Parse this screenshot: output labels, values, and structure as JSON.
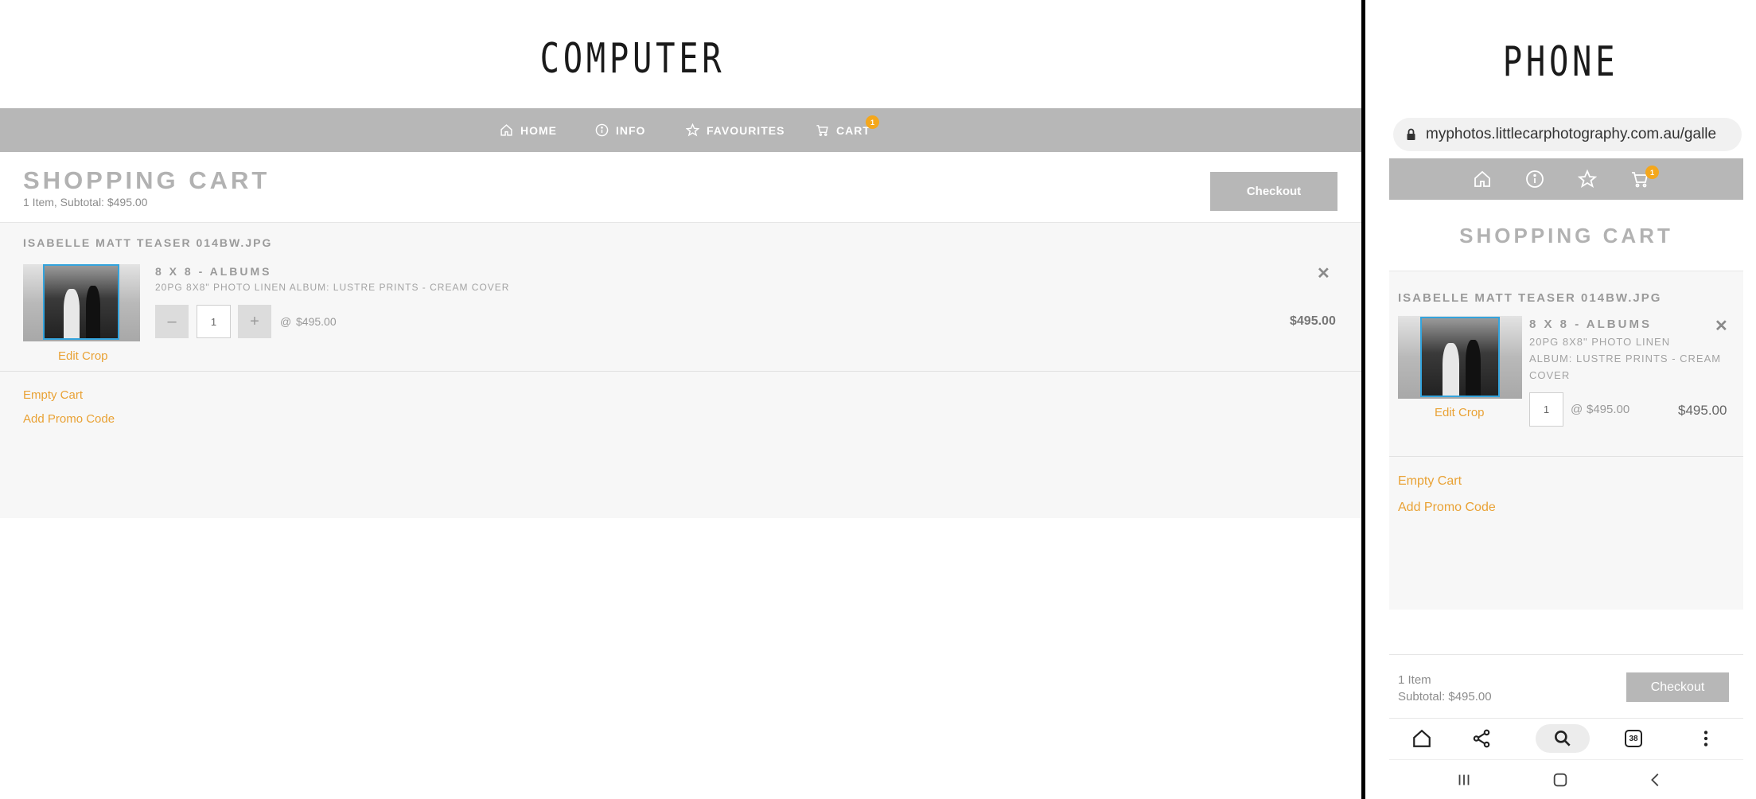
{
  "labels": {
    "computer": "COMPUTER",
    "phone": "PHONE"
  },
  "nav": {
    "home": "HOME",
    "info": "INFO",
    "favourites": "FAVOURITES",
    "cart": "CART",
    "cart_count": "1"
  },
  "cart": {
    "title": "SHOPPING CART",
    "summary": "1 Item, Subtotal: $495.00",
    "checkout_label": "Checkout",
    "item": {
      "file_name": "ISABELLE MATT TEASER 014BW.JPG",
      "product_title": "8 X 8 - ALBUMS",
      "product_desc": "20PG 8X8\" PHOTO LINEN ALBUM: LUSTRE PRINTS - CREAM COVER",
      "quantity": "1",
      "unit_price": "$495.00",
      "at": "@",
      "line_total": "$495.00",
      "edit_crop": "Edit Crop",
      "remove": "✕",
      "minus": "–",
      "plus": "+"
    },
    "empty_cart": "Empty Cart",
    "promo": "Add Promo Code"
  },
  "phone": {
    "url": "myphotos.littlecarphotography.com.au/galle",
    "product_desc_lines": [
      "20PG 8X8\" PHOTO LINEN",
      "ALBUM: LUSTRE PRINTS - CREAM",
      "COVER"
    ],
    "footer_count": "1 Item",
    "footer_subtotal": "Subtotal: $495.00",
    "tab_count": "38"
  },
  "colors": {
    "accent": "#f4a71c",
    "link": "#e9a235",
    "nav_bg": "#b7b7b7",
    "crop_border": "#34a4dd"
  }
}
